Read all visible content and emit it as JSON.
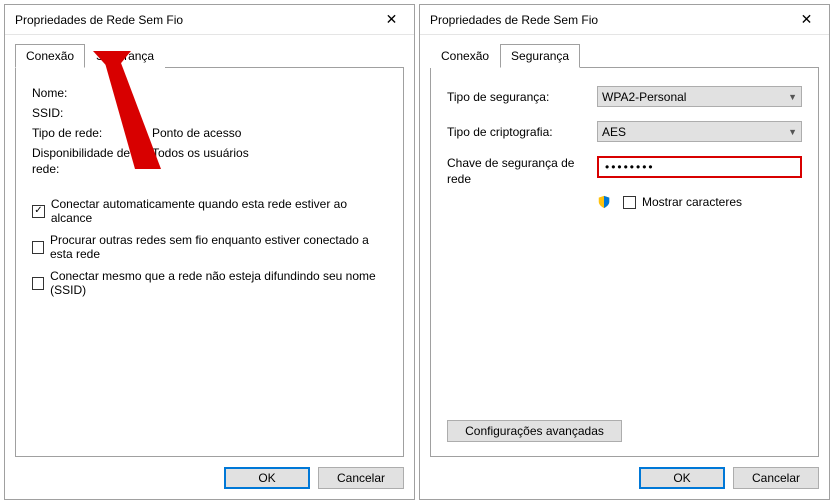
{
  "left": {
    "title": "Propriedades de Rede Sem Fio",
    "tabs": {
      "connection": "Conexão",
      "security": "Segurança"
    },
    "fields": {
      "name_label": "Nome:",
      "ssid_label": "SSID:",
      "nettype_label": "Tipo de rede:",
      "nettype_value": "Ponto de acesso",
      "avail_label": "Disponibilidade de rede:",
      "avail_value": "Todos os usuários"
    },
    "checks": {
      "auto": "Conectar automaticamente quando esta rede estiver ao alcance",
      "lookother": "Procurar outras redes sem fio enquanto estiver conectado a esta rede",
      "hidden": "Conectar mesmo que a rede não esteja difundindo seu nome (SSID)"
    },
    "buttons": {
      "ok": "OK",
      "cancel": "Cancelar"
    }
  },
  "right": {
    "title": "Propriedades de Rede Sem Fio",
    "tabs": {
      "connection": "Conexão",
      "security": "Segurança"
    },
    "sectype_label": "Tipo de segurança:",
    "sectype_value": "WPA2-Personal",
    "enc_label": "Tipo de criptografia:",
    "enc_value": "AES",
    "key_label": "Chave de segurança de rede",
    "key_value": "••••••••",
    "showchars": "Mostrar caracteres",
    "advanced": "Configurações avançadas",
    "buttons": {
      "ok": "OK",
      "cancel": "Cancelar"
    }
  }
}
